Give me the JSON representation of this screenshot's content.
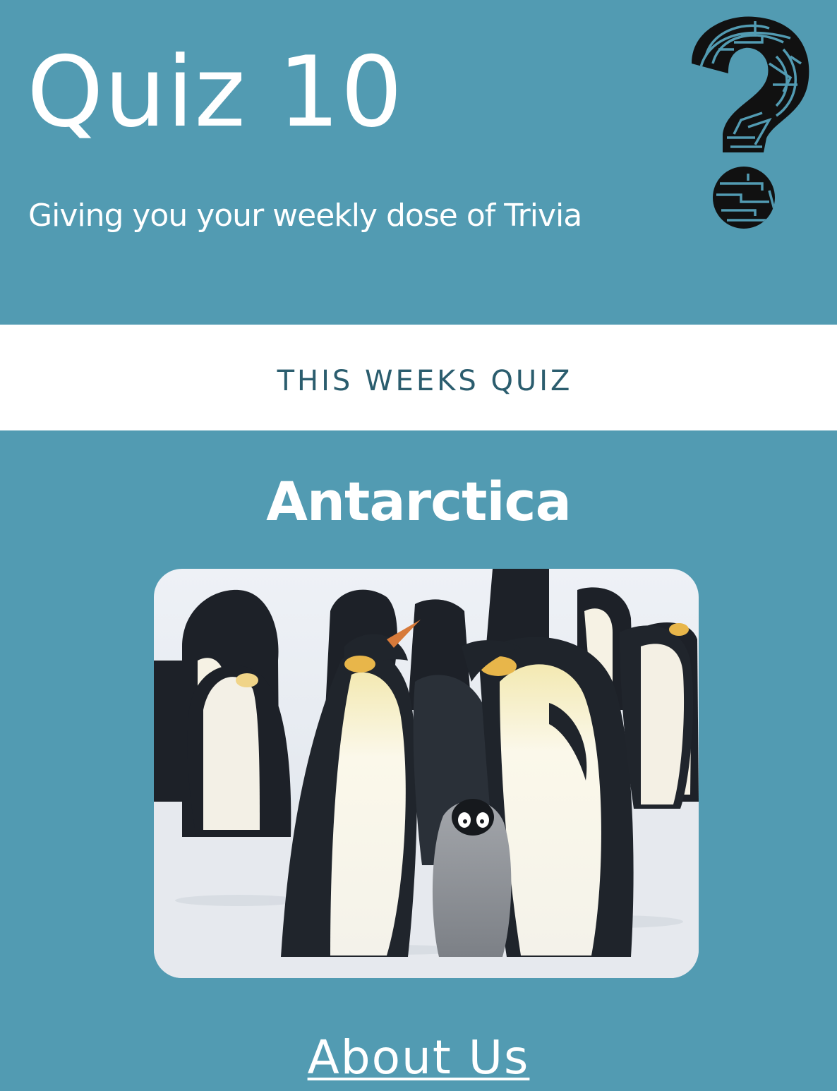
{
  "header": {
    "title": "Quiz 10",
    "tagline": "Giving you your weekly dose of Trivia",
    "logo_icon": "maze-question-mark-icon"
  },
  "band": {
    "label": "THIS WEEKS QUIZ"
  },
  "quiz": {
    "title": "Antarctica",
    "image_subject": "penguins-photo"
  },
  "footer": {
    "about_label": "About Us"
  },
  "colors": {
    "primary": "#529bb2",
    "band_bg": "#ffffff",
    "band_text": "#2b5d6e",
    "text": "#ffffff"
  }
}
